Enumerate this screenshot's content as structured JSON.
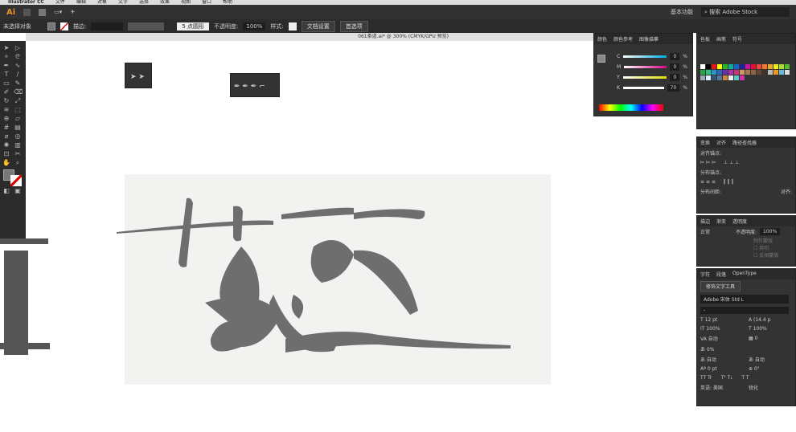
{
  "menu": [
    "Illustrator CC",
    "文件",
    "编辑",
    "对象",
    "文字",
    "选择",
    "效果",
    "视图",
    "窗口",
    "帮助"
  ],
  "app": {
    "logo": "Ai",
    "workspace": "基本功能",
    "search_placeholder": "搜索 Adobe Stock"
  },
  "control": {
    "selection": "未选择对象",
    "stroke_label": "描边:",
    "brush": "5 点圆形",
    "opacity_label": "不透明度:",
    "opacity": "100%",
    "style_label": "样式:",
    "doc_setup": "文档设置",
    "prefs": "首选项"
  },
  "document": {
    "title": "061茶道.ai* @ 300% (CMYK/GPU 预览)"
  },
  "color_panel": {
    "tabs": [
      "颜色",
      "颜色参考",
      "图像描摹"
    ],
    "channels": [
      {
        "label": "C",
        "value": "0"
      },
      {
        "label": "M",
        "value": "0"
      },
      {
        "label": "Y",
        "value": "0"
      },
      {
        "label": "K",
        "value": "70"
      }
    ],
    "unit": "%"
  },
  "swatches_panel": {
    "tabs": [
      "色板",
      "画笔",
      "符号"
    ],
    "colors": [
      "#fff",
      "#000",
      "#e11",
      "#ff0",
      "#2b2",
      "#1a9",
      "#16c",
      "#229",
      "#c1a",
      "#d13",
      "#e43",
      "#e73",
      "#ea2",
      "#ee2",
      "#ad2",
      "#5b3",
      "#2a4",
      "#3b8",
      "#29c",
      "#36b",
      "#63a",
      "#a3a",
      "#c37",
      "#c96",
      "#a75",
      "#864",
      "#643",
      "#432",
      "#bbb",
      "#e92",
      "#6bd",
      "#ddd",
      "#9ab",
      "#def",
      "#357",
      "#579",
      "#c84",
      "#eee",
      "#5cc",
      "#c3a"
    ]
  },
  "align_panel": {
    "tabs": [
      "变换",
      "对齐",
      "路径查找器"
    ],
    "align_anchors": "对齐锚点:",
    "distribute_anchors": "分布锚点:",
    "distribute_spacing": "分布间距:",
    "align_to": "对齐:"
  },
  "transparency_panel": {
    "tabs": [
      "描边",
      "渐变",
      "透明度"
    ],
    "mode": "正常",
    "opacity_label": "不透明度:",
    "opacity": "100%",
    "make_mask": "制作蒙版",
    "clip": "剪切",
    "invert": "反相蒙版"
  },
  "character_panel": {
    "tabs": [
      "字符",
      "段落",
      "OpenType"
    ],
    "touch_type": "修饰文字工具",
    "font": "Adobe 宋体 Std L",
    "style": "-",
    "size": "12 pt",
    "leading": "(14.4 p",
    "vscale": "100%",
    "hscale": "100%",
    "kerning": "自动",
    "tracking": "0",
    "tsume": "0%",
    "aki_left": "自动",
    "aki_right": "自动",
    "baseline": "0 pt",
    "rotation": "0°",
    "language": "英语: 美国",
    "antialias": "锐化"
  }
}
